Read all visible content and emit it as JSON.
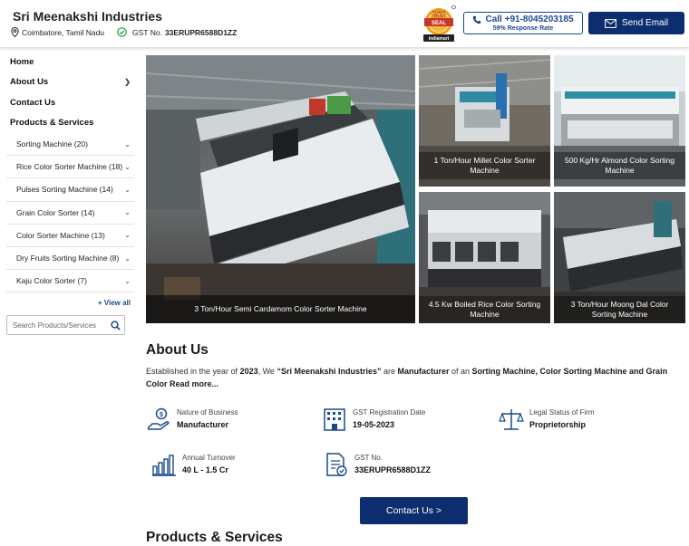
{
  "header": {
    "company_name": "Sri Meenakshi Industries",
    "location": "Coimbatore, Tamil Nadu",
    "gst_prefix": "GST No.",
    "gst_number": "33ERUPR6588D1ZZ",
    "trust_seal": {
      "top": "Verified",
      "mid1": "TRUST",
      "mid2": "SEAL",
      "bottom": "indiamart"
    },
    "call_label": "Call +91-8045203185",
    "call_sub": "59% Response Rate",
    "email_label": "Send Email"
  },
  "sidebar": {
    "top_items": [
      {
        "label": "Home"
      },
      {
        "label": "About Us"
      },
      {
        "label": "Contact Us"
      },
      {
        "label": "Products & Services"
      }
    ],
    "sub_items": [
      {
        "label": "Sorting Machine (20)"
      },
      {
        "label": "Rice Color Sorter Machine (18)"
      },
      {
        "label": "Pulses Sorting Machine (14)"
      },
      {
        "label": "Grain Color Sorter (14)"
      },
      {
        "label": "Color Sorter Machine (13)"
      },
      {
        "label": "Dry Fruits Sorting Machine (8)"
      },
      {
        "label": "Kaju Color Sorter (7)"
      }
    ],
    "view_all": "+ View all",
    "search_placeholder": "Search Products/Services"
  },
  "gallery": [
    {
      "caption": "3 Ton/Hour Semi Cardamom Color Sorter Machine"
    },
    {
      "caption": "1 Ton/Hour Millet Color Sorter Machine"
    },
    {
      "caption": "500 Kg/Hr Almond Color Sorting Machine"
    },
    {
      "caption": "4.5 Kw Boiled Rice Color Sorting Machine"
    },
    {
      "caption": "3 Ton/Hour Moong Dal Color Sorting Machine"
    }
  ],
  "about": {
    "title": "About Us",
    "text_1": "Established in the year of ",
    "year": "2023",
    "text_2": ", We ",
    "company_quoted": "“Sri Meenakshi Industries”",
    "text_3": " are ",
    "role": "Manufacturer",
    "text_4": " of an ",
    "products": "Sorting Machine, Color Sorting Machine and Grain Color",
    "read_more": "Read more...",
    "facts": [
      {
        "label": "Nature of Business",
        "value": "Manufacturer"
      },
      {
        "label": "GST Registration Date",
        "value": "19-05-2023"
      },
      {
        "label": "Legal Status of Firm",
        "value": "Proprietorship"
      },
      {
        "label": "Annual Turnover",
        "value": "40 L - 1.5 Cr"
      },
      {
        "label": "GST No.",
        "value": "33ERUPR6588D1ZZ"
      }
    ]
  },
  "contact_button": "Contact Us >",
  "products_title": "Products & Services",
  "colors": {
    "brand_navy": "#0d2e6e",
    "link_blue": "#1b4a8c",
    "trust_orange": "#f39c12",
    "trust_red": "#c0392b"
  }
}
